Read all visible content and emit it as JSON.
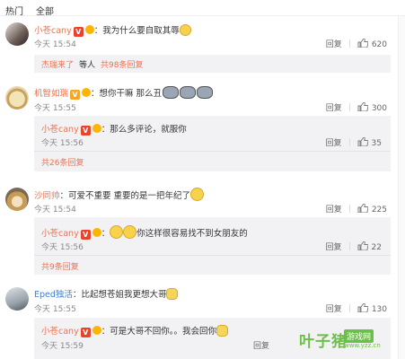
{
  "tabs": {
    "hot": "热门",
    "all": "全部"
  },
  "comments": [
    {
      "user": "小苍cany",
      "colon": "：",
      "text": "我为什么要自取其辱",
      "time": "今天 15:54",
      "reply": "回复",
      "likes": "620",
      "more_user": "杰瑞来了",
      "more_mid": "等人",
      "more_link": "共98条回复"
    },
    {
      "user": "机智如瑞",
      "colon": "：",
      "text": "想你干嘛  那么丑",
      "time": "今天 15:55",
      "reply": "回复",
      "likes": "300",
      "sub": {
        "user": "小苍cany",
        "colon": "：",
        "text": "那么多评论，就服你",
        "time": "今天 15:56",
        "reply": "回复",
        "likes": "35"
      },
      "more_link": "共26条回复"
    },
    {
      "user": "沙同帅",
      "colon": "：",
      "text": "可爱不重要 重要的是一把年纪了",
      "time": "今天 15:54",
      "reply": "回复",
      "likes": "225",
      "sub": {
        "user": "小苍cany",
        "colon": "：",
        "text": "你这样很容易找不到女朋友的",
        "time": "今天 15:56",
        "reply": "回复",
        "likes": "22"
      },
      "more_link": "共9条回复"
    },
    {
      "user": "Eped独活",
      "colon": "：",
      "text": "比起想苍姐我更想大哥",
      "time": "今天 15:55",
      "reply": "回复",
      "likes": "130",
      "sub": {
        "user": "小苍cany",
        "colon": "：",
        "text": "可是大哥不回你。。我会回你",
        "time": "今天 15:59",
        "reply": "回复"
      }
    }
  ],
  "watermark": {
    "brand": "叶子猪",
    "tag": "游戏网",
    "url": "www.yzz.cn"
  },
  "colors": {
    "username": "#eb7350",
    "accent": "#3b7dd8",
    "watermark": "#6cc04a"
  }
}
